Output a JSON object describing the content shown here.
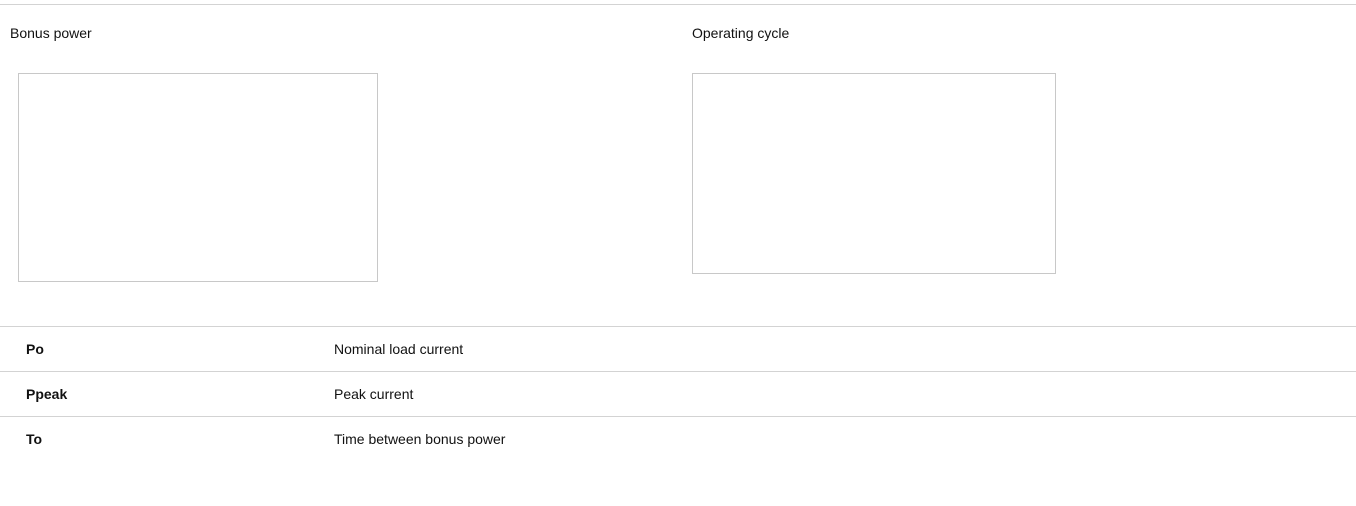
{
  "images_table": {
    "columns": [
      {
        "header": "Bonus power"
      },
      {
        "header": "Operating cycle"
      }
    ]
  },
  "definitions": [
    {
      "term": "Po",
      "description": "Nominal load current"
    },
    {
      "term": "Ppeak",
      "description": "Peak current"
    },
    {
      "term": "To",
      "description": "Time between bonus power"
    }
  ]
}
